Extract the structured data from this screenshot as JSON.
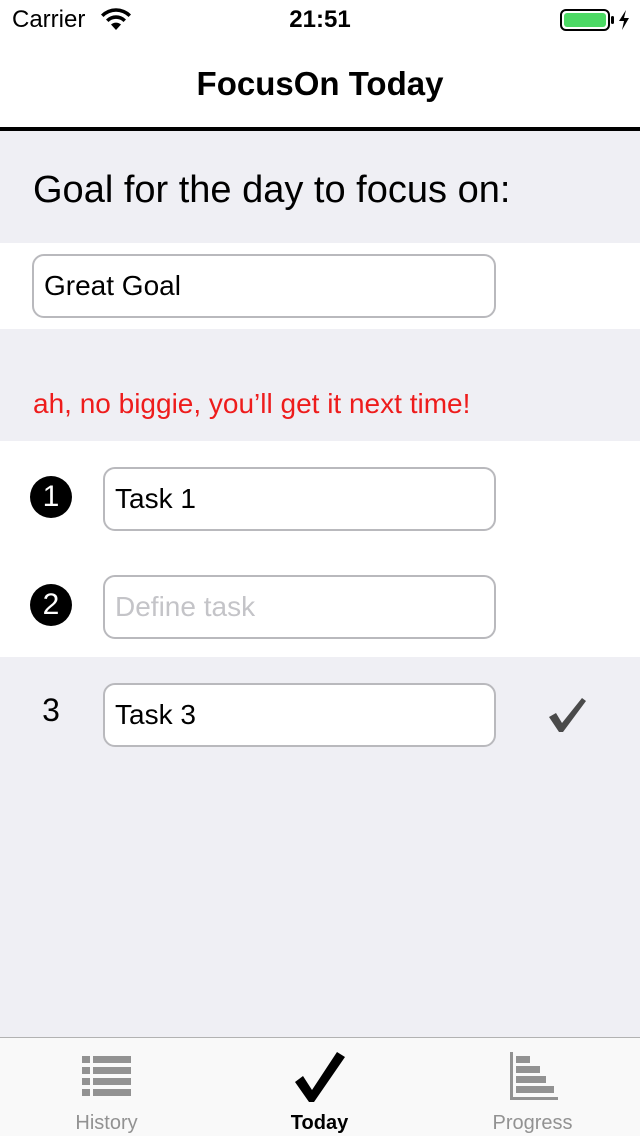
{
  "status_bar": {
    "carrier": "Carrier",
    "time": "21:51",
    "wifi_icon": "wifi-icon",
    "battery_icon": "battery-icon",
    "charging_icon": "bolt-icon",
    "battery_color": "#4cd964"
  },
  "nav": {
    "title": "FocusOn Today"
  },
  "goal": {
    "header": "Goal for the day to focus on:",
    "value": "Great Goal",
    "placeholder": ""
  },
  "feedback": {
    "text": "ah, no biggie, you’ll get it next time!",
    "color": "#ee1c1c"
  },
  "tasks": [
    {
      "number": "1",
      "value": "Task 1",
      "placeholder": "Define task",
      "completed": false
    },
    {
      "number": "2",
      "value": "",
      "placeholder": "Define task",
      "completed": false
    },
    {
      "number": "3",
      "value": "Task 3",
      "placeholder": "Define task",
      "completed": true,
      "icon": "checkmark-icon"
    }
  ],
  "tab_bar": {
    "items": [
      {
        "label": "History",
        "icon": "list-icon",
        "selected": false
      },
      {
        "label": "Today",
        "icon": "checkmark-icon",
        "selected": true
      },
      {
        "label": "Progress",
        "icon": "bar-chart-icon",
        "selected": false
      }
    ]
  },
  "colors": {
    "background_gray": "#efeff4",
    "feedback_red": "#ee1c1c",
    "tab_inactive": "#929292",
    "tab_active": "#000000"
  }
}
